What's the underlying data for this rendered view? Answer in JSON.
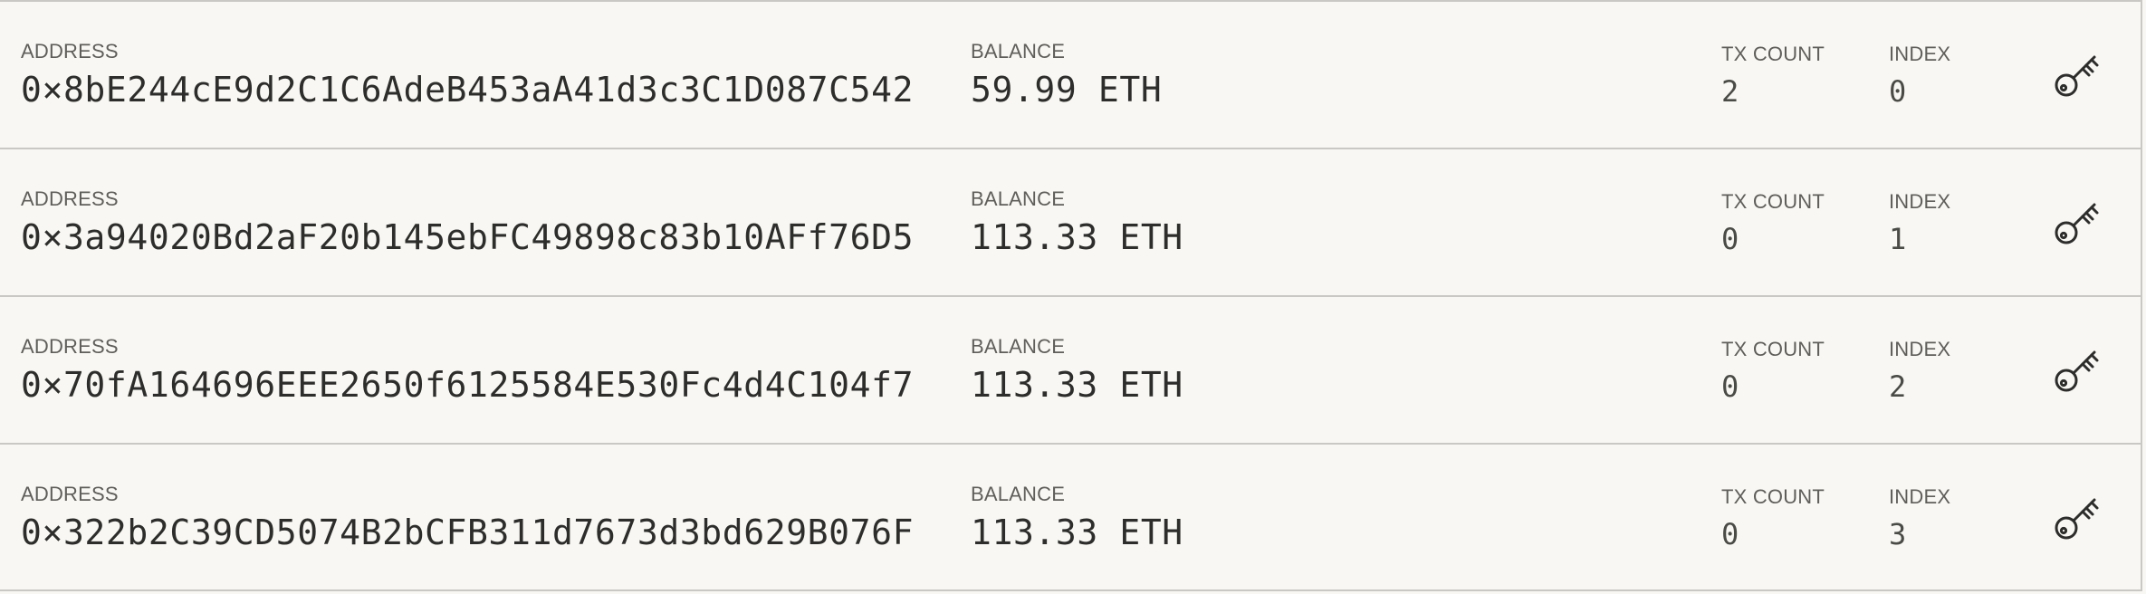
{
  "labels": {
    "address": "ADDRESS",
    "balance": "BALANCE",
    "tx_count": "TX COUNT",
    "index": "INDEX"
  },
  "accounts": [
    {
      "address": "0×8bE244cE9d2C1C6AdeB453aA41d3c3C1D087C542",
      "balance": "59.99 ETH",
      "tx_count": "2",
      "index": "0",
      "action_icon": "key-icon"
    },
    {
      "address": "0×3a94020Bd2aF20b145ebFC49898c83b10AFf76D5",
      "balance": "113.33 ETH",
      "tx_count": "0",
      "index": "1",
      "action_icon": "key-icon"
    },
    {
      "address": "0×70fA164696EEE2650f6125584E530Fc4d4C104f7",
      "balance": "113.33 ETH",
      "tx_count": "0",
      "index": "2",
      "action_icon": "key-icon"
    },
    {
      "address": "0×322b2C39CD5074B2bCFB311d7673d3bd629B076F",
      "balance": "113.33 ETH",
      "tx_count": "0",
      "index": "3",
      "action_icon": "key-icon"
    }
  ],
  "colors": {
    "background": "#f8f7f4",
    "divider": "#c9c8c4",
    "label_text": "#5f5e5a",
    "value_text": "#2d2d2b"
  }
}
